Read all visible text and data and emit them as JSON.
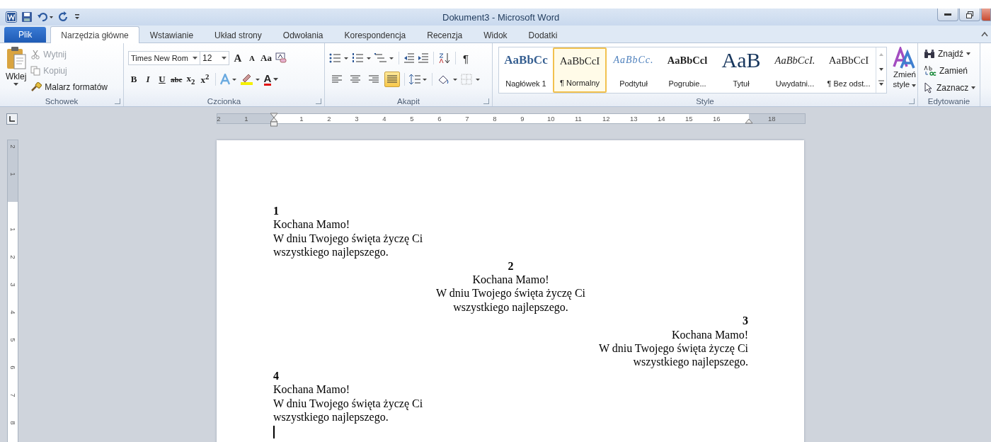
{
  "window": {
    "title": "Dokument3 - Microsoft Word"
  },
  "tabs": [
    {
      "label": "Plik",
      "kind": "file",
      "selected": false
    },
    {
      "label": "Narzędzia główne",
      "kind": "tab",
      "selected": true
    },
    {
      "label": "Wstawianie",
      "kind": "tab",
      "selected": false
    },
    {
      "label": "Układ strony",
      "kind": "tab",
      "selected": false
    },
    {
      "label": "Odwołania",
      "kind": "tab",
      "selected": false
    },
    {
      "label": "Korespondencja",
      "kind": "tab",
      "selected": false
    },
    {
      "label": "Recenzja",
      "kind": "tab",
      "selected": false
    },
    {
      "label": "Widok",
      "kind": "tab",
      "selected": false
    },
    {
      "label": "Dodatki",
      "kind": "tab",
      "selected": false
    }
  ],
  "clipboard": {
    "label": "Schowek",
    "paste": "Wklej",
    "items": [
      {
        "label": "Wytnij",
        "kind": "cut",
        "disabled": true
      },
      {
        "label": "Kopiuj",
        "kind": "copy",
        "disabled": true
      },
      {
        "label": "Malarz formatów",
        "kind": "painter",
        "disabled": false
      }
    ]
  },
  "font": {
    "label": "Czcionka",
    "family": "Times New Rom",
    "size": "12",
    "grow": "A",
    "shrink": "A",
    "case": "Aa",
    "format_buttons": [
      {
        "text": "B",
        "kind": "bold"
      },
      {
        "text": "I",
        "kind": "italic"
      },
      {
        "text": "U",
        "kind": "underline"
      },
      {
        "text": "abc",
        "kind": "strike"
      },
      {
        "text": "x$_{2}$",
        "kind": "sub"
      },
      {
        "text": "x$^{2}$",
        "kind": "sup"
      }
    ],
    "color_letter": "A"
  },
  "paragraph": {
    "label": "Akapit",
    "pilcrow": "¶",
    "alignments": [
      {
        "kind": "left",
        "selected": false
      },
      {
        "kind": "center",
        "selected": false
      },
      {
        "kind": "right",
        "selected": false
      },
      {
        "kind": "justify",
        "selected": true
      }
    ]
  },
  "styles": {
    "label": "Style",
    "items": [
      {
        "preview": "AaBbCc",
        "label": "Nagłówek 1",
        "kind": "heading",
        "selected": false
      },
      {
        "preview": "AaBbCcI",
        "label": "¶ Normalny",
        "kind": "normal",
        "selected": true
      },
      {
        "preview": "AaBbCc.",
        "label": "Podtytuł",
        "kind": "subtitle",
        "selected": false
      },
      {
        "preview": "AaBbCcl",
        "label": "Pogrubie...",
        "kind": "strong",
        "selected": false
      },
      {
        "preview": "AaB",
        "label": "Tytuł",
        "kind": "title",
        "selected": false
      },
      {
        "preview": "AaBbCcI.",
        "label": "Uwydatni...",
        "kind": "emphasis",
        "selected": false
      },
      {
        "preview": "AaBbCcI",
        "label": "¶ Bez odst...",
        "kind": "normal",
        "selected": false
      }
    ],
    "change": [
      "Zmień",
      "style"
    ]
  },
  "editing": {
    "label": "Edytowanie",
    "items": [
      {
        "label": "Znajdź",
        "kind": "find"
      },
      {
        "label": "Zamień",
        "kind": "replace"
      },
      {
        "label": "Zaznacz",
        "kind": "select"
      }
    ]
  },
  "ruler": {
    "horizontal": [
      "2",
      "1",
      "1",
      "2",
      "3",
      "4",
      "5",
      "6",
      "7",
      "8",
      "9",
      "10",
      "11",
      "12",
      "13",
      "14",
      "15",
      "16",
      "18"
    ],
    "vertical": [
      "2",
      "1",
      "1",
      "2",
      "3",
      "4",
      "5",
      "6",
      "7",
      "8"
    ]
  },
  "document": {
    "cursor": true,
    "blocks": [
      {
        "kind": "left",
        "number": "1",
        "lines": [
          "Kochana Mamo!",
          "W dniu Twojego święta życzę Ci",
          "wszystkiego najlepszego."
        ]
      },
      {
        "kind": "center",
        "number": "2",
        "lines": [
          "Kochana Mamo!",
          "W dniu Twojego święta życzę Ci",
          "wszystkiego najlepszego."
        ]
      },
      {
        "kind": "right",
        "number": "3",
        "lines": [
          "Kochana Mamo!",
          "W dniu Twojego święta życzę Ci",
          "wszystkiego najlepszego."
        ]
      },
      {
        "kind": "left",
        "number": "4",
        "lines": [
          "Kochana Mamo!",
          "W dniu Twojego święta życzę Ci",
          "wszystkiego najlepszego."
        ]
      }
    ]
  }
}
